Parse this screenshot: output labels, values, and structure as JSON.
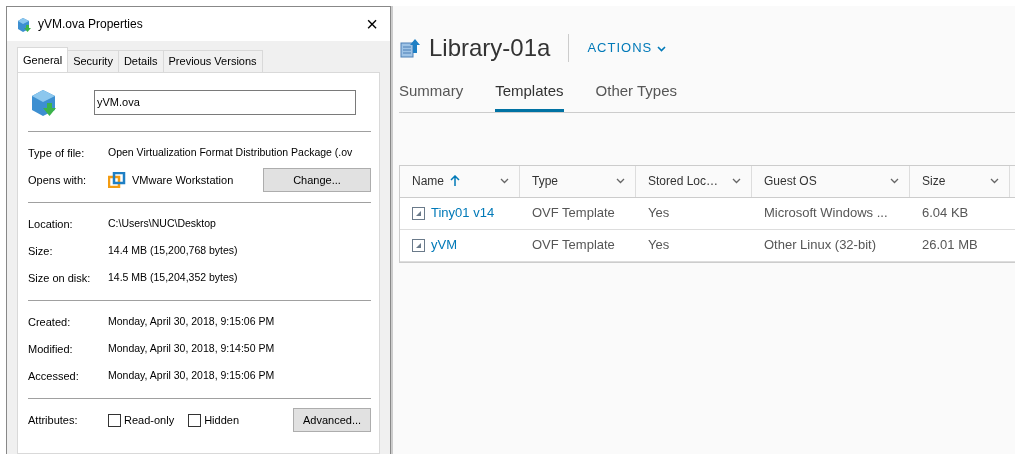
{
  "dialog": {
    "title": "yVM.ova Properties",
    "close": "×",
    "tabs": [
      {
        "label": "General",
        "selected": true
      },
      {
        "label": "Security",
        "selected": false
      },
      {
        "label": "Details",
        "selected": false
      },
      {
        "label": "Previous Versions",
        "selected": false
      }
    ],
    "file_name": "yVM.ova",
    "sections": [
      [
        {
          "kind": "text",
          "label": "Type of file:",
          "value": "Open Virtualization Format Distribution Package (.ov"
        },
        {
          "kind": "app",
          "label": "Opens with:",
          "value": "VMware Workstation",
          "button": "Change..."
        }
      ],
      [
        {
          "kind": "text",
          "label": "Location:",
          "value": "C:\\Users\\NUC\\Desktop"
        },
        {
          "kind": "text",
          "label": "Size:",
          "value": "14.4 MB (15,200,768 bytes)"
        },
        {
          "kind": "text",
          "label": "Size on disk:",
          "value": "14.5 MB (15,204,352 bytes)"
        }
      ],
      [
        {
          "kind": "text",
          "label": "Created:",
          "value": "Monday, April 30, 2018, 9:15:06 PM"
        },
        {
          "kind": "text",
          "label": "Modified:",
          "value": "Monday, April 30, 2018, 9:14:50 PM"
        },
        {
          "kind": "text",
          "label": "Accessed:",
          "value": "Monday, April 30, 2018, 9:15:06 PM"
        }
      ]
    ],
    "attributes": {
      "label": "Attributes:",
      "checkboxes": [
        {
          "label": "Read-only",
          "checked": false
        },
        {
          "label": "Hidden",
          "checked": false
        }
      ],
      "button": "Advanced..."
    }
  },
  "library": {
    "title": "Library-01a",
    "actions": "ACTIONS",
    "tabs": [
      {
        "label": "Summary",
        "selected": false
      },
      {
        "label": "Templates",
        "selected": true
      },
      {
        "label": "Other Types",
        "selected": false
      }
    ],
    "table": {
      "columns": [
        {
          "label": "Name",
          "sorted": true
        },
        {
          "label": "Type",
          "sorted": false
        },
        {
          "label": "Stored Loc…",
          "sorted": false
        },
        {
          "label": "Guest OS",
          "sorted": false
        },
        {
          "label": "Size",
          "sorted": false
        }
      ],
      "rows": [
        [
          "Tiny01 v14",
          "OVF Template",
          "Yes",
          "Microsoft Windows ...",
          "6.04 KB"
        ],
        [
          "yVM",
          "OVF Template",
          "Yes",
          "Other Linux (32-bit)",
          "26.01 MB"
        ]
      ]
    }
  }
}
